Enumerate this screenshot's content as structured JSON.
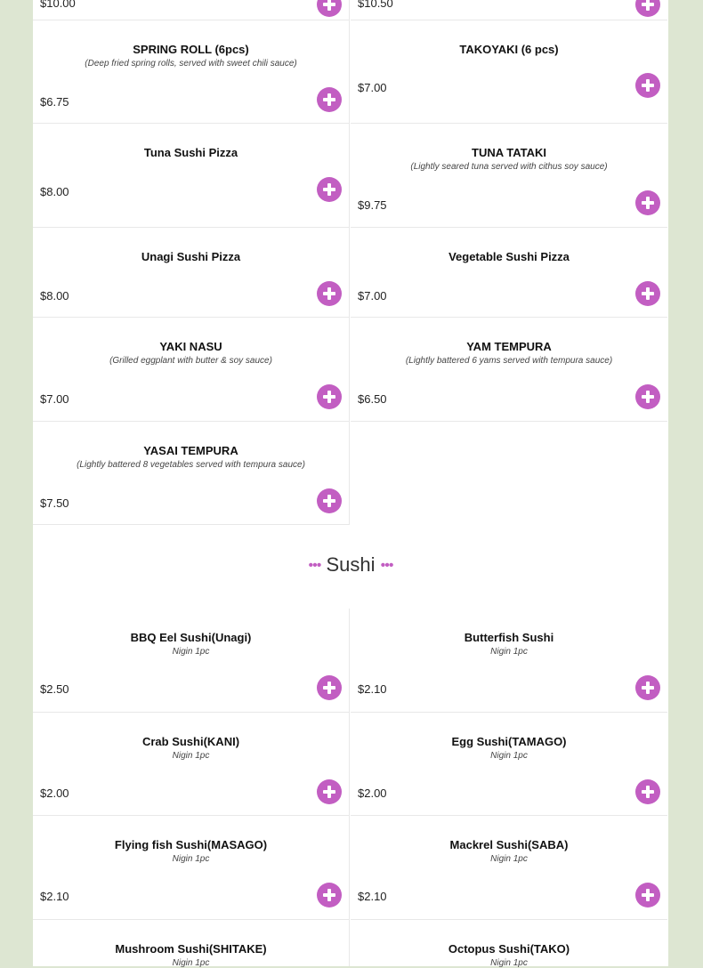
{
  "top_partial": {
    "left_price": "$10.00",
    "right_price": "$10.50"
  },
  "appetizers": [
    {
      "name": "SPRING ROLL (6pcs)",
      "desc": "(Deep fried spring rolls, served with sweet chili sauce)",
      "price": "$6.75"
    },
    {
      "name": "TAKOYAKI (6 pcs)",
      "desc": "",
      "price": "$7.00"
    },
    {
      "name": "Tuna Sushi Pizza",
      "desc": "",
      "price": "$8.00"
    },
    {
      "name": "TUNA TATAKI",
      "desc": "(Lightly seared tuna served with cithus soy sauce)",
      "price": "$9.75"
    },
    {
      "name": "Unagi Sushi Pizza",
      "desc": "",
      "price": "$8.00"
    },
    {
      "name": "Vegetable Sushi Pizza",
      "desc": "",
      "price": "$7.00"
    },
    {
      "name": "YAKI NASU",
      "desc": "(Grilled eggplant with butter & soy sauce)",
      "price": "$7.00"
    },
    {
      "name": "YAM TEMPURA",
      "desc": "(Lightly battered 6 yams served with tempura sauce)",
      "price": "$6.50"
    },
    {
      "name": "YASAI TEMPURA",
      "desc": "(Lightly battered 8 vegetables served with tempura sauce)",
      "price": "$7.50"
    }
  ],
  "sushi_section": {
    "dots_left": "•••",
    "title": "Sushi",
    "dots_right": "•••"
  },
  "sushi": [
    {
      "name": "BBQ Eel Sushi(Unagi)",
      "desc": "Nigin 1pc",
      "price": "$2.50"
    },
    {
      "name": "Butterfish Sushi",
      "desc": "Nigin 1pc",
      "price": "$2.10"
    },
    {
      "name": "Crab Sushi(KANI)",
      "desc": "Nigin 1pc",
      "price": "$2.00"
    },
    {
      "name": "Egg Sushi(TAMAGO)",
      "desc": "Nigin 1pc",
      "price": "$2.00"
    },
    {
      "name": "Flying fish Sushi(MASAGO)",
      "desc": "Nigin 1pc",
      "price": "$2.10"
    },
    {
      "name": "Mackrel Sushi(SABA)",
      "desc": "Nigin 1pc",
      "price": "$2.10"
    },
    {
      "name": "Mushroom Sushi(SHITAKE)",
      "desc": "Nigin 1pc",
      "price": ""
    },
    {
      "name": "Octopus Sushi(TAKO)",
      "desc": "Nigin 1pc",
      "price": ""
    }
  ],
  "colors": {
    "accent": "#c25ec2",
    "background": "#dde6d2",
    "panel": "#ffffff"
  },
  "icons": {
    "add": "plus-circle-icon"
  }
}
